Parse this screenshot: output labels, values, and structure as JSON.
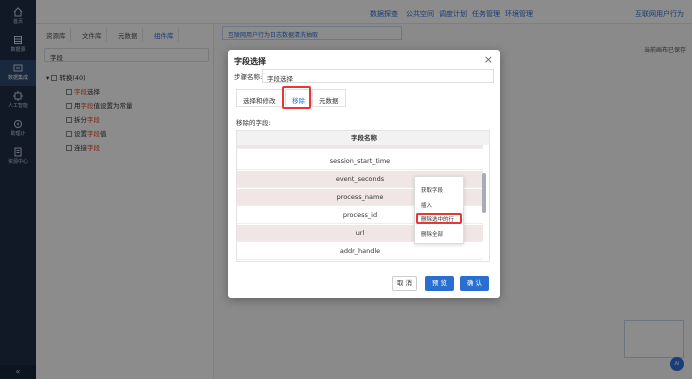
{
  "nav": {
    "items": [
      {
        "label": "首页",
        "icon": "home-icon"
      },
      {
        "label": "数据源",
        "icon": "database-icon"
      },
      {
        "label": "数据集成",
        "icon": "integration-icon"
      },
      {
        "label": "人工智能",
        "icon": "ai-icon"
      },
      {
        "label": "助理计",
        "icon": "assistant-icon"
      },
      {
        "label": "资源中心",
        "icon": "resource-icon"
      }
    ],
    "collapse_label": "«"
  },
  "topbar": {
    "links": [
      "数据探查",
      "公共空间",
      "调度计划",
      "任务管理",
      "环境管理"
    ],
    "project": "互联网用户行为"
  },
  "leftpanel": {
    "tabs": [
      "资源库",
      "文件库",
      "元数据",
      "组件库"
    ],
    "active_tab": "组件库",
    "search_value": "字段",
    "tree_root": "转换(40)",
    "tree_items": [
      {
        "pre": "",
        "hl": "字段",
        "post": "选择"
      },
      {
        "pre": "用",
        "hl": "字段",
        "post": "值设置为常量"
      },
      {
        "pre": "拆分",
        "hl": "字段",
        "post": ""
      },
      {
        "pre": "设置",
        "hl": "字段",
        "post": "值"
      },
      {
        "pre": "连接",
        "hl": "字段",
        "post": ""
      }
    ]
  },
  "main": {
    "doc_tab": "互联网用户行为日志数据清洗抽取",
    "autosave": "当前画布已保存",
    "ai_label": "AI"
  },
  "dialog": {
    "title": "字段选择",
    "step_label": "步骤名称:",
    "step_value": "字段选择",
    "tabs": [
      "选择和修改",
      "移除",
      "元数据"
    ],
    "active_tab": "移除",
    "remove_label": "移除的字段:",
    "table_header": "字段名称",
    "rows": [
      "session_start_time",
      "event_seconds",
      "process_name",
      "process_id",
      "url",
      "addr_handle"
    ],
    "buttons": {
      "cancel": "取 消",
      "preview": "预 览",
      "ok": "确 认"
    }
  },
  "context_menu": {
    "items": [
      "获取字段",
      "插入",
      "删除选中的行",
      "删除全部"
    ],
    "highlighted": "删除选中的行"
  }
}
